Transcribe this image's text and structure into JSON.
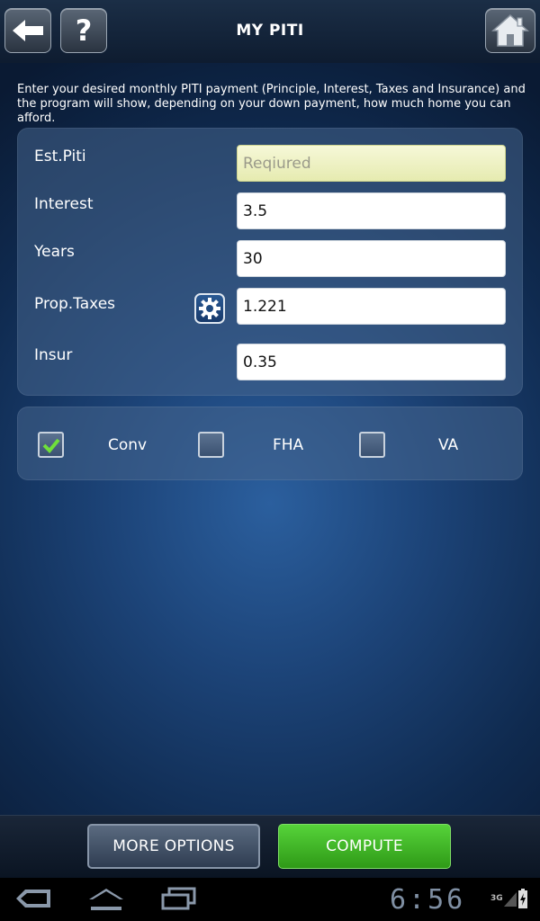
{
  "header": {
    "title": "MY PITI",
    "back_icon": "back-arrow-icon",
    "help_label": "?",
    "home_icon": "home-icon"
  },
  "intro_text": "Enter your desired monthly PITI payment (Principle, Interest, Taxes and Insurance) and the program will show, depending on your down payment, how much home you can afford.",
  "form": {
    "est_piti": {
      "label": "Est.Piti",
      "value": "",
      "placeholder": "Reqiured"
    },
    "interest": {
      "label": "Interest",
      "value": "3.5"
    },
    "years": {
      "label": "Years",
      "value": "30"
    },
    "prop_taxes": {
      "label": "Prop.Taxes",
      "value": "1.221",
      "icon": "gear-icon"
    },
    "insur": {
      "label": "Insur",
      "value": "0.35"
    }
  },
  "loan_types": [
    {
      "label": "Conv",
      "checked": true
    },
    {
      "label": "FHA",
      "checked": false
    },
    {
      "label": "VA",
      "checked": false
    }
  ],
  "buttons": {
    "more_options": "MORE OPTIONS",
    "compute": "COMPUTE"
  },
  "system_bar": {
    "time": "6:56",
    "network": "3G"
  },
  "colors": {
    "compute_green": "#3fb523",
    "check_green": "#6fe03a",
    "required_field": "#eef2c4"
  }
}
